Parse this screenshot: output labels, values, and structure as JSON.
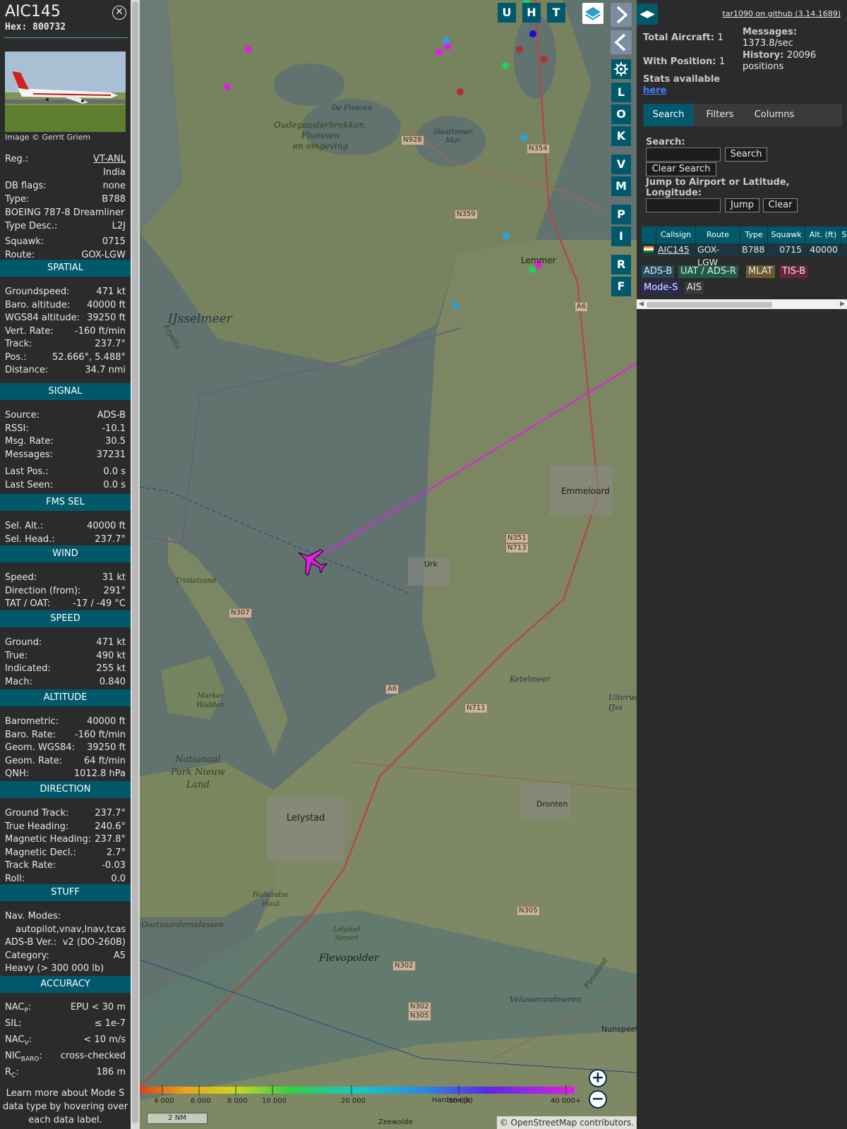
{
  "aircraft": {
    "callsign": "AIC145",
    "hex_label": "Hex:",
    "hex": "800732",
    "photo_credit": "Image © Gerrit Griem"
  },
  "details": [
    {
      "k": "Reg.:",
      "v": "VT-ANL",
      "link": true
    },
    {
      "k": "",
      "v": "India"
    },
    {
      "k": "DB flags:",
      "v": "none"
    },
    {
      "k": "Type:",
      "v": "B788"
    },
    {
      "full": "BOEING 787-8 Dreamliner"
    },
    {
      "k": "Type Desc.:",
      "v": "L2J"
    },
    {
      "k": "Squawk:",
      "v": "0715"
    },
    {
      "k": "Route:",
      "v": "GOX-LGW"
    }
  ],
  "sections": {
    "spatial": "SPATIAL",
    "signal": "SIGNAL",
    "fms": "FMS SEL",
    "wind": "WIND",
    "speed": "SPEED",
    "altitude": "ALTITUDE",
    "direction": "DIRECTION",
    "stuff": "STUFF",
    "accuracy": "ACCURACY"
  },
  "spatial": [
    {
      "k": "Groundspeed:",
      "v": "471 kt"
    },
    {
      "k": "Baro. altitude:",
      "v": "40000 ft"
    },
    {
      "k": "WGS84 altitude:",
      "v": "39250 ft"
    },
    {
      "k": "Vert. Rate:",
      "v": "-160 ft/min"
    },
    {
      "k": "Track:",
      "v": "237.7°"
    },
    {
      "k": "Pos.:",
      "v": "52.666°, 5.488°"
    },
    {
      "k": "Distance:",
      "v": "34.7 nmi"
    }
  ],
  "signal": [
    {
      "k": "Source:",
      "v": "ADS-B"
    },
    {
      "k": "RSSI:",
      "v": "-10.1"
    },
    {
      "k": "Msg. Rate:",
      "v": "30.5"
    },
    {
      "k": "Messages:",
      "v": "37231"
    },
    {
      "k": "Last Pos.:",
      "v": "0.0 s"
    },
    {
      "k": "Last Seen:",
      "v": "0.0 s"
    }
  ],
  "fms": [
    {
      "k": "Sel. Alt.:",
      "v": "40000 ft"
    },
    {
      "k": "Sel. Head.:",
      "v": "237.7°"
    }
  ],
  "wind": [
    {
      "k": "Speed:",
      "v": "31 kt"
    },
    {
      "k": "Direction (from):",
      "v": "291°"
    },
    {
      "k": "TAT / OAT:",
      "v": "-17 / -49 °C"
    }
  ],
  "speed": [
    {
      "k": "Ground:",
      "v": "471 kt"
    },
    {
      "k": "True:",
      "v": "490 kt"
    },
    {
      "k": "Indicated:",
      "v": "255 kt"
    },
    {
      "k": "Mach:",
      "v": "0.840"
    }
  ],
  "altitude": [
    {
      "k": "Barometric:",
      "v": "40000 ft"
    },
    {
      "k": "Baro. Rate:",
      "v": "-160 ft/min"
    },
    {
      "k": "Geom. WGS84:",
      "v": "39250 ft"
    },
    {
      "k": "Geom. Rate:",
      "v": "64 ft/min"
    },
    {
      "k": "QNH:",
      "v": "1012.8 hPa"
    }
  ],
  "direction": [
    {
      "k": "Ground Track:",
      "v": "237.7°"
    },
    {
      "k": "True Heading:",
      "v": "240.6°"
    },
    {
      "k": "Magnetic Heading:",
      "v": "237.8°"
    },
    {
      "k": "Magnetic Decl.:",
      "v": "2.7°"
    },
    {
      "k": "Track Rate:",
      "v": "-0.03"
    },
    {
      "k": "Roll:",
      "v": "0.0"
    }
  ],
  "stuff": [
    {
      "k": "Nav. Modes:",
      "v": ""
    },
    {
      "indent": "autopilot,vnav,lnav,tcas"
    },
    {
      "k": "ADS-B Ver.:",
      "v": "v2 (DO-260B)"
    },
    {
      "k": "Category:",
      "v": "A5"
    },
    {
      "full": "Heavy (> 300 000 lb)"
    }
  ],
  "accuracy": [
    {
      "k": "NAC",
      "sub": "P",
      "v": "EPU < 30 m"
    },
    {
      "k": "SIL:",
      "v": "≤ 1e-7"
    },
    {
      "k": "NAC",
      "sub": "V",
      "v": "< 10 m/s"
    },
    {
      "k": "NIC",
      "sub": "BARO",
      "v": "cross-checked"
    },
    {
      "k": "R",
      "sub": "C",
      "v": "186 m"
    }
  ],
  "learn_more": [
    "Learn more about Mode S",
    "data type by hovering over",
    "each data label."
  ],
  "map": {
    "labels": {
      "oudega": [
        "Oudegaasterbrekken,",
        "Fluessen",
        "en omgeving"
      ],
      "fluezen": "De Fluezen",
      "slotermeer": [
        "Sleattemer",
        "Mar"
      ],
      "ijsselmeer": "IJsselmeer",
      "fryslan": "Fryslân",
      "lemmer": "Lemmer",
      "emmeloord": "Emmeloord",
      "urk": "Urk",
      "trintelzand": "Trintelzand",
      "ketelmeer": "Ketelmeer",
      "uiterwaarden": [
        "Uiterwa",
        "IJss"
      ],
      "marker": [
        "Marker",
        "Wadden"
      ],
      "nationaal": [
        "Nationaal",
        "Park Nieuw",
        "Land"
      ],
      "lelystad": "Lelystad",
      "dronten": "Dronten",
      "hollandse": [
        "Hollandse",
        "Hout"
      ],
      "oostvaarders": "Oostvaardersplassen",
      "airport": [
        "Lelystad",
        "Airport"
      ],
      "flevopolder": "Flevopolder",
      "veluwe": "Veluwerandmeren",
      "nunspeet": "Nunspeet",
      "flevoland": "Flevoland",
      "harderwijk": "Harderwijk",
      "zeewolde": "Zeewolde"
    },
    "roads": {
      "n928": "N928",
      "n354": "N354",
      "n359": "N359",
      "a6a": "A6",
      "n351": "N351",
      "n713": "N713",
      "n307": "N307",
      "a6b": "A6",
      "n711": "N711",
      "n305": "N305",
      "n302": "N302",
      "n302b": "N302",
      "n305b": "N305"
    },
    "toolbar": {
      "u": "U",
      "h": "H",
      "t": "T",
      "l": "L",
      "o": "O",
      "k": "K",
      "v": "V",
      "m": "M",
      "p": "P",
      "i": "I",
      "r": "R",
      "f": "F"
    },
    "colorbar_labels": [
      "4 000",
      "6 000",
      "8 000",
      "10 000",
      "20 000",
      "30 000",
      "40 000+"
    ],
    "scale": "2 NM",
    "attribution": "© OpenStreetMap contributors.",
    "zoom_in": "+",
    "zoom_out": "−"
  },
  "side": {
    "github": "tar1090 on github (3.14.1689)",
    "total_label": "Total Aircraft:",
    "total": "1",
    "withpos_label": "With Position:",
    "withpos": "1",
    "stats_label": "Stats available",
    "stats_link": "here",
    "messages_label": "Messages:",
    "messages": "1373.8/sec",
    "history_label": "History:",
    "history": "20096 positions",
    "tabs": [
      "Search",
      "Filters",
      "Columns"
    ],
    "search_label": "Search:",
    "search_btn": "Search",
    "clear_search_btn": "Clear Search",
    "jump_label": "Jump to Airport or Latitude, Longitude:",
    "jump_btn": "Jump",
    "clear_btn": "Clear",
    "table": {
      "headers": [
        "Callsign",
        "Route",
        "Type",
        "Squawk",
        "Alt. (ft)",
        "S"
      ],
      "row": {
        "callsign": "AIC145",
        "route": "GOX-LGW",
        "type": "B788",
        "squawk": "0715",
        "alt": "40000"
      }
    },
    "legend": [
      {
        "label": "ADS-B",
        "color": "#1f4a5e"
      },
      {
        "label": "UAT / ADS-R",
        "color": "#1f5a46"
      },
      {
        "label": "MLAT",
        "color": "#6a5a2a"
      },
      {
        "label": "TIS-B",
        "color": "#6a2440"
      },
      {
        "label": "Mode-S",
        "color": "#2a2a5e"
      },
      {
        "label": "AIS",
        "color": "#3a3a3a"
      }
    ]
  },
  "colors": {
    "accent": "#00596b",
    "track": "#e020e0",
    "plane": "#e020e0"
  }
}
